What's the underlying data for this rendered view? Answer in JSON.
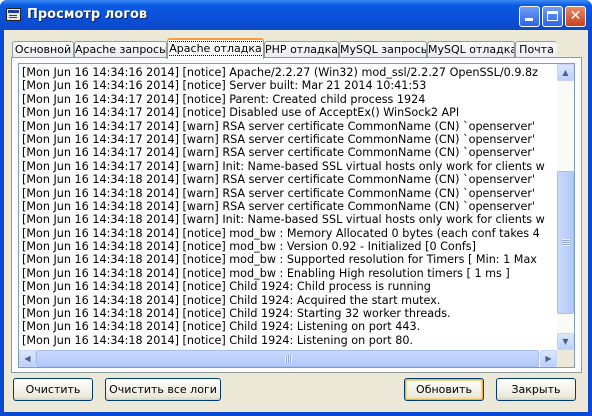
{
  "window": {
    "title": "Просмотр логов"
  },
  "tabs": [
    {
      "label": "Основной",
      "active": false
    },
    {
      "label": "Apache запросы",
      "active": false
    },
    {
      "label": "Apache отладка",
      "active": true
    },
    {
      "label": "PHP отладка",
      "active": false
    },
    {
      "label": "MySQL запросы",
      "active": false
    },
    {
      "label": "MySQL отладка",
      "active": false
    },
    {
      "label": "Почта",
      "active": false
    }
  ],
  "log_lines": [
    "[Mon Jun 16 14:34:16 2014] [notice] Apache/2.2.27 (Win32) mod_ssl/2.2.27 OpenSSL/0.9.8z",
    "[Mon Jun 16 14:34:16 2014] [notice] Server built: Mar 21 2014 10:41:53",
    "[Mon Jun 16 14:34:17 2014] [notice] Parent: Created child process 1924",
    "[Mon Jun 16 14:34:17 2014] [notice] Disabled use of AcceptEx() WinSock2 API",
    "[Mon Jun 16 14:34:17 2014] [warn] RSA server certificate CommonName (CN) `openserver'",
    "[Mon Jun 16 14:34:17 2014] [warn] RSA server certificate CommonName (CN) `openserver'",
    "[Mon Jun 16 14:34:17 2014] [warn] RSA server certificate CommonName (CN) `openserver'",
    "[Mon Jun 16 14:34:17 2014] [warn] Init: Name-based SSL virtual hosts only work for clients w",
    "[Mon Jun 16 14:34:18 2014] [warn] RSA server certificate CommonName (CN) `openserver'",
    "[Mon Jun 16 14:34:18 2014] [warn] RSA server certificate CommonName (CN) `openserver'",
    "[Mon Jun 16 14:34:18 2014] [warn] RSA server certificate CommonName (CN) `openserver'",
    "[Mon Jun 16 14:34:18 2014] [warn] Init: Name-based SSL virtual hosts only work for clients w",
    "[Mon Jun 16 14:34:18 2014] [notice] mod_bw : Memory Allocated 0 bytes (each conf takes 4",
    "[Mon Jun 16 14:34:18 2014] [notice] mod_bw : Version 0.92 - Initialized [0 Confs]",
    "[Mon Jun 16 14:34:18 2014] [notice] mod_bw : Supported resolution for Timers [ Min: 1 Max",
    "[Mon Jun 16 14:34:18 2014] [notice] mod_bw : Enabling High resolution timers [ 1 ms ]",
    "[Mon Jun 16 14:34:18 2014] [notice] Child 1924: Child process is running",
    "[Mon Jun 16 14:34:18 2014] [notice] Child 1924: Acquired the start mutex.",
    "[Mon Jun 16 14:34:18 2014] [notice] Child 1924: Starting 32 worker threads.",
    "[Mon Jun 16 14:34:18 2014] [notice] Child 1924: Listening on port 443.",
    "[Mon Jun 16 14:34:18 2014] [notice] Child 1924: Listening on port 80."
  ],
  "buttons": {
    "clear": "Очистить",
    "clear_all": "Очистить все логи",
    "refresh": "Обновить",
    "close": "Закрыть"
  },
  "icons": {
    "app": "console-window-icon",
    "minimize": "minimize-icon",
    "maximize": "maximize-icon",
    "close": "close-icon"
  }
}
